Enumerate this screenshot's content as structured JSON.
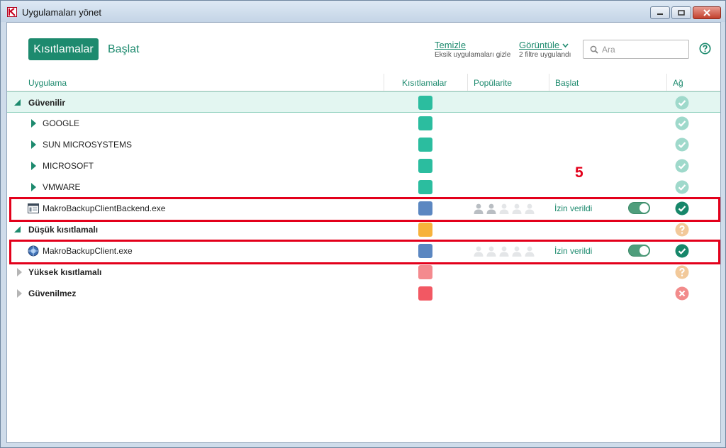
{
  "window": {
    "title": "Uygulamaları yönet"
  },
  "header": {
    "tab_active": "Kısıtlamalar",
    "tab_start": "Başlat",
    "clean_link": "Temizle",
    "clean_sub": "Eksik uygulamaları gizle",
    "view_link": "Görüntüle",
    "view_sub": "2 filtre uygulandı",
    "search_placeholder": "Ara"
  },
  "columns": {
    "app": "Uygulama",
    "restrictions": "Kısıtlamalar",
    "popularity": "Popülarite",
    "start": "Başlat",
    "network": "Ağ"
  },
  "rows": [
    {
      "kind": "group",
      "label": "Güvenilir",
      "expanded": true,
      "swatch": "#2bbd9f",
      "net": "check-light"
    },
    {
      "kind": "vendor",
      "label": "GOOGLE",
      "swatch": "#2bbd9f",
      "net": "check-light"
    },
    {
      "kind": "vendor",
      "label": "SUN MICROSYSTEMS",
      "swatch": "#2bbd9f",
      "net": "check-light"
    },
    {
      "kind": "vendor",
      "label": "MICROSOFT",
      "swatch": "#2bbd9f",
      "net": "check-light"
    },
    {
      "kind": "vendor",
      "label": "VMWARE",
      "swatch": "#2bbd9f",
      "net": "check-light"
    },
    {
      "kind": "app",
      "label": "MakroBackupClientBackend.exe",
      "icon": "window-app-icon",
      "swatch": "#5b87c1",
      "popularity": 2,
      "status": "İzin verildi",
      "toggle_on": true,
      "net": "check-dark"
    },
    {
      "kind": "group",
      "label": "Düşük kısıtlamalı",
      "expanded": true,
      "swatch": "#f7b23b",
      "net": "question"
    },
    {
      "kind": "app",
      "label": "MakroBackupClient.exe",
      "icon": "globe-app-icon",
      "swatch": "#5b87c1",
      "popularity": 0,
      "status": "İzin verildi",
      "toggle_on": true,
      "net": "check-dark"
    },
    {
      "kind": "group",
      "label": "Yüksek kısıtlamalı",
      "expanded": false,
      "swatch": "#f48a8e",
      "net": "question"
    },
    {
      "kind": "group",
      "label": "Güvenilmez",
      "expanded": false,
      "swatch": "#f25863",
      "net": "cross"
    }
  ],
  "annotation": {
    "marker": "5"
  },
  "colors": {
    "accent": "#1d8a6e",
    "highlight": "#e3001b",
    "check_light": "#9fd9cb",
    "check_dark": "#17876a",
    "question": "#f2c99a",
    "cross": "#f28b8b"
  }
}
